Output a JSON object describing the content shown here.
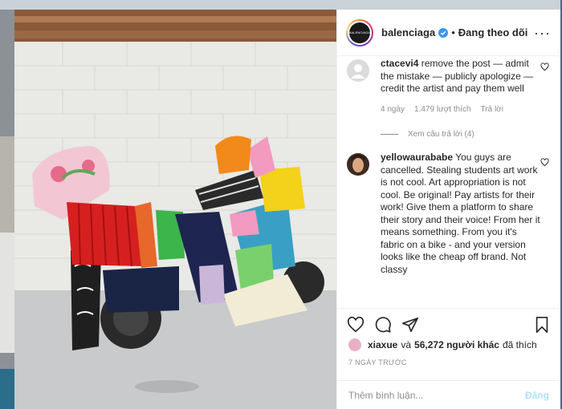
{
  "header": {
    "username": "balenciaga",
    "avatar_text": "BALENCIAGA",
    "separator": "•",
    "follow_status": "Đang theo dõi",
    "more_icon": "more-horizontal-icon"
  },
  "comments": [
    {
      "username": "ctacevi4",
      "text": "remove the post — admit the mistake — publicly apologize — credit the artist and pay them well",
      "time": "4 ngày",
      "likes": "1.479 lượt thích",
      "reply": "Trả lời",
      "view_replies": "Xem câu trả lời (4)"
    },
    {
      "username": "yellowaurababe",
      "text": "You guys are cancelled. Stealing students art work is not cool. Art appropriation is not cool. Be original! Pay artists for their work! Give them a platform to share their story and their voice! From her it means something. From you it's fabric on a bike - and your version looks like the cheap off brand. Not classy"
    }
  ],
  "actions": {
    "like_icon": "heart-icon",
    "comment_icon": "comment-icon",
    "share_icon": "send-icon",
    "save_icon": "bookmark-icon"
  },
  "likes": {
    "first_user": "xiaxue",
    "connector": "và",
    "others": "56,272 người khác",
    "suffix": "đã thích"
  },
  "date": "7 NGÀY TRƯỚC",
  "add_comment": {
    "placeholder": "Thêm bình luận...",
    "post_label": "Đăng"
  },
  "colors": {
    "link_blue": "#0095f6",
    "post_disabled": "#b2dffc",
    "muted": "#8e8e8e",
    "verified": "#3897f0"
  }
}
